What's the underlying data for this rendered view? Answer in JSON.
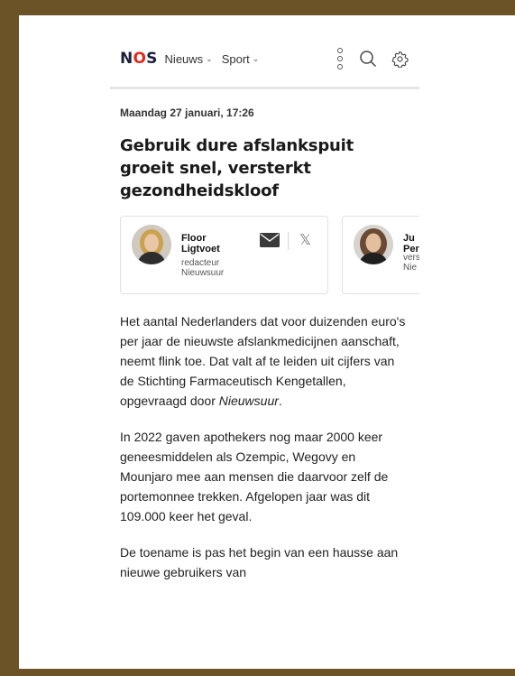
{
  "header": {
    "logo": {
      "letters": [
        "N",
        "O",
        "S"
      ]
    },
    "nav": [
      {
        "label": "Nieuws"
      },
      {
        "label": "Sport"
      }
    ],
    "icons": [
      "more-vertical-icon",
      "search-icon",
      "settings-icon"
    ]
  },
  "article": {
    "date": "Maandag 27 januari, 17:26",
    "title": "Gebruik dure afslankspuit groeit snel, versterkt gezondheidskloof",
    "authors": [
      {
        "name_line1": "Floor",
        "name_line2": "Ligtvoet",
        "role_line1": "redacteur",
        "role_line2": "Nieuwsuur"
      },
      {
        "name_line1": "Ju",
        "name_line2": "Per",
        "role_line1": "vers",
        "role_line2": "Nie"
      }
    ],
    "paragraph_1_pre": "Het aantal Nederlanders dat voor duizenden euro's per jaar de nieuwste afslankmedicijnen aanschaft, neemt flink toe. Dat valt af te leiden uit cijfers van de Stichting Farmaceutisch Kengetallen, opgevraagd door ",
    "paragraph_1_em": "Nieuwsuur",
    "paragraph_1_post": ".",
    "paragraph_2": "In 2022 gaven apothekers nog maar 2000 keer geneesmiddelen als Ozempic, Wegovy en Mounjaro mee aan mensen die daarvoor zelf de portemonnee trekken. Afgelopen jaar was dit 109.000 keer het geval.",
    "paragraph_3": "De toename is pas het begin van een hausse aan nieuwe gebruikers van"
  },
  "colors": {
    "frame": "#6b5327",
    "brand_red": "#e0281d",
    "brand_navy": "#1b1f3b"
  }
}
